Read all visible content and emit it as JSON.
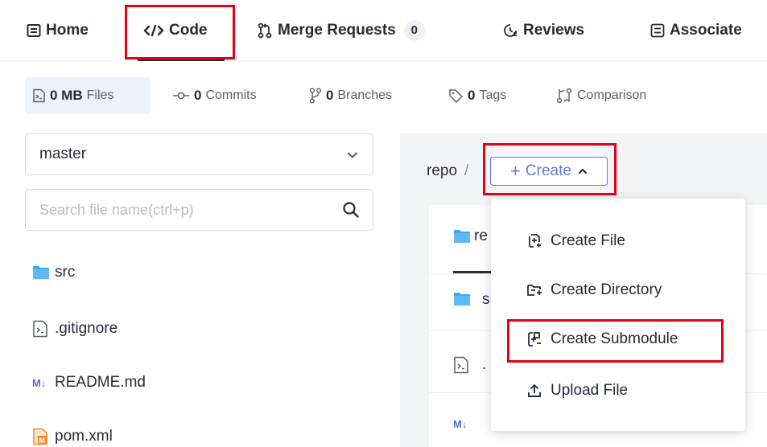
{
  "nav": {
    "home": "Home",
    "code": "Code",
    "merge_requests": "Merge Requests",
    "merge_requests_count": "0",
    "reviews": "Reviews",
    "associated": "Associate"
  },
  "stats": {
    "files_value": "0 MB",
    "files_label": "Files",
    "commits_value": "0",
    "commits_label": "Commits",
    "branches_value": "0",
    "branches_label": "Branches",
    "tags_value": "0",
    "tags_label": "Tags",
    "comparison_label": "Comparison"
  },
  "sidebar": {
    "branch": "master",
    "search_placeholder": "Search file name(ctrl+p)",
    "files": [
      {
        "name": "src",
        "icon": "folder-icon"
      },
      {
        "name": ".gitignore",
        "icon": "file-icon"
      },
      {
        "name": "README.md",
        "icon": "markdown-icon"
      },
      {
        "name": "pom.xml",
        "icon": "maven-icon"
      }
    ]
  },
  "main": {
    "breadcrumb_repo": "repo",
    "breadcrumb_sep": "/",
    "create_label": "Create",
    "card_tab_label": "re",
    "rows": [
      {
        "icon": "folder-icon",
        "text": "s"
      },
      {
        "icon": "file-icon",
        "text": "."
      },
      {
        "icon": "markdown-icon",
        "text": ""
      }
    ]
  },
  "create_menu": {
    "items": [
      {
        "label": "Create File",
        "icon": "create-file-icon"
      },
      {
        "label": "Create Directory",
        "icon": "create-directory-icon"
      },
      {
        "label": "Create Submodule",
        "icon": "create-submodule-icon"
      },
      {
        "label": "Upload File",
        "icon": "upload-icon"
      }
    ]
  },
  "colors": {
    "accent": "#5e7ce0",
    "folder": "#3fa9f5",
    "markdown": "#526ecc",
    "maven": "#f28b2c",
    "highlight": "#e60012",
    "text": "#252b3a"
  }
}
